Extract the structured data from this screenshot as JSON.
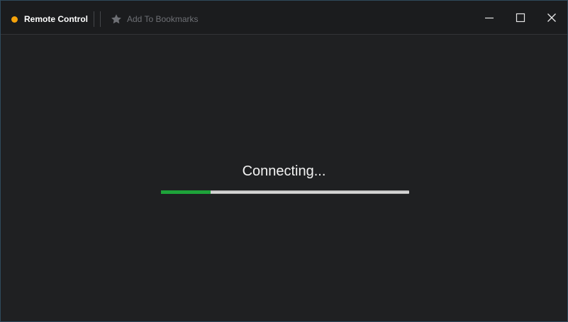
{
  "titlebar": {
    "app_title": "Remote Control",
    "status_color": "#f5a20a",
    "bookmark_label": "Add To Bookmarks",
    "bookmark_icon": "star-icon",
    "window_buttons": [
      "minimize-icon",
      "maximize-icon",
      "close-icon"
    ]
  },
  "main": {
    "status_text": "Connecting...",
    "progress": 0.2,
    "progress_color": "#1ea33a"
  }
}
